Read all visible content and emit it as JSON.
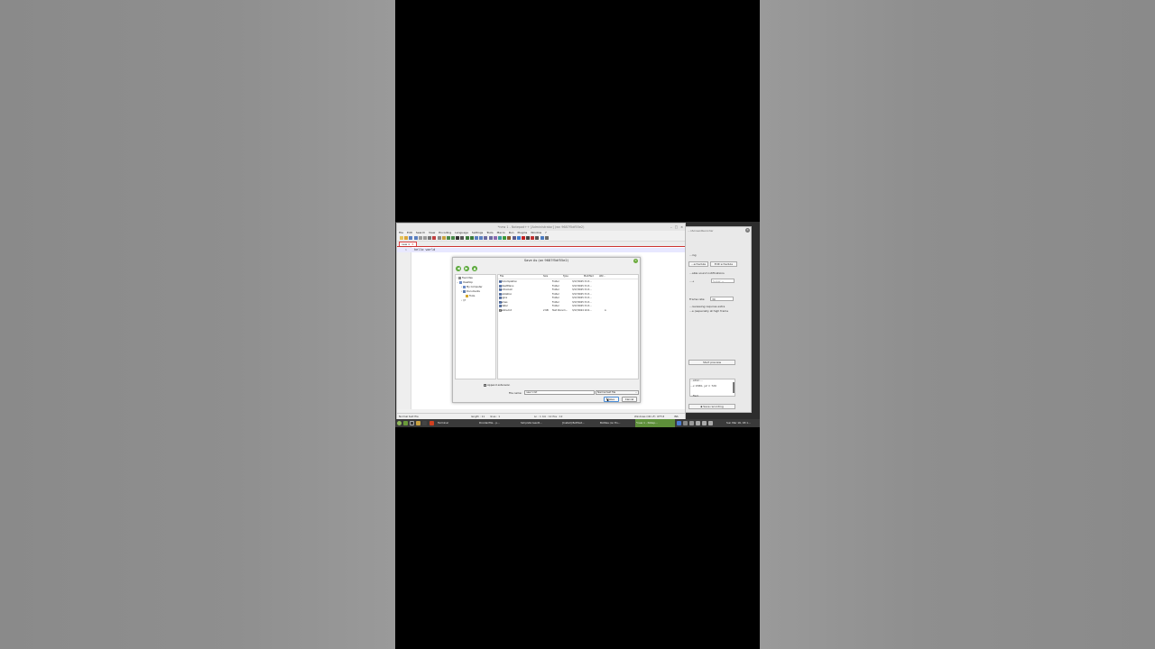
{
  "notepad": {
    "title": "*new 1 - Notepad++ [Administrator] (wn 9687f5df55e2)",
    "menu": [
      "File",
      "Edit",
      "Search",
      "View",
      "Encoding",
      "Language",
      "Settings",
      "Tools",
      "Macro",
      "Run",
      "Plugins",
      "Window",
      "?"
    ],
    "tab_label": "new 1",
    "line_number": "1",
    "code_text": "hello world",
    "status": {
      "doc_type": "Normal text file",
      "length": "length : 11",
      "lines": "lines : 1",
      "position": "Ln : 1    Col : 12    Pos : 12",
      "eol": "Windows (CR LF)",
      "encoding": "UTF-8",
      "mode": "INS"
    }
  },
  "dialog": {
    "title": "Save As (on 9687f5df55e2)",
    "tree": {
      "favorites": "Favorites",
      "desktop": "Desktop",
      "my_computer": "My Computer",
      "documents": "Documents",
      "tools": "Tools",
      "more": "\\\\?"
    },
    "columns": {
      "file": "File",
      "size": "Size",
      "type": "Type",
      "modified": "Modified",
      "attributes": "Attr..."
    },
    "files": [
      {
        "name": "autoCompletion",
        "size": "",
        "type": "Folder",
        "modified": "3/17/2025 3:13..."
      },
      {
        "name": "contextMenu",
        "size": "",
        "type": "Folder",
        "modified": "3/17/2025 3:13..."
      },
      {
        "name": "functionList",
        "size": "",
        "type": "Folder",
        "modified": "3/17/2025 3:13..."
      },
      {
        "name": "localization",
        "size": "",
        "type": "Folder",
        "modified": "3/17/2025 3:13..."
      },
      {
        "name": "plugins",
        "size": "",
        "type": "Folder",
        "modified": "3/17/2025 3:13..."
      },
      {
        "name": "themes",
        "size": "",
        "type": "Folder",
        "modified": "3/17/2025 3:13..."
      },
      {
        "name": "updater",
        "size": "",
        "type": "Folder",
        "modified": "3/17/2025 3:13..."
      },
      {
        "name": "readme.txt",
        "size": "2 KB",
        "type": "Text Docum...",
        "modified": "3/17/2024 10:0...",
        "attr": "A"
      }
    ],
    "append_extension": "Append extension",
    "file_name_label": "File name:",
    "file_name_value": "new 1.txt",
    "file_type": "Normal text file",
    "save_label": "Save",
    "cancel_label": "Cancel"
  },
  "recorder": {
    "title": "...nScreenRecorder",
    "ng_label": "...ing",
    "schedule_label": "...schedule",
    "edit_schedule": "Edit schedule",
    "sound_notifications": "...able sound notifications",
    "hotkey": "...+",
    "hotkey_key": "Super +",
    "frame_rate_label": "Frame rate:",
    "frame_rate_value": "30",
    "note_line1": "...reviewing requires extra",
    "note_line2": "...e (especially at high frame",
    "start_preview": "Start preview",
    "log_line1": "...ation ...",
    "log_line2": "...x 1580, y2 = 720",
    "log_line3": "...fied.",
    "save_recording": "Save recording"
  },
  "taskbar": {
    "items": [
      "Terminal",
      "Droidarifile - p...",
      "SimpleScreenR...",
      "[Install] BottSet...",
      "Bottles (on fin...",
      "*new 1 - Notep..."
    ],
    "clock": "Sun Mar 16, 03:1..."
  },
  "colors": {
    "accent_green": "#5e8f3a",
    "tab_red": "#d44444",
    "dialog_button_green": "#5aa83a"
  }
}
